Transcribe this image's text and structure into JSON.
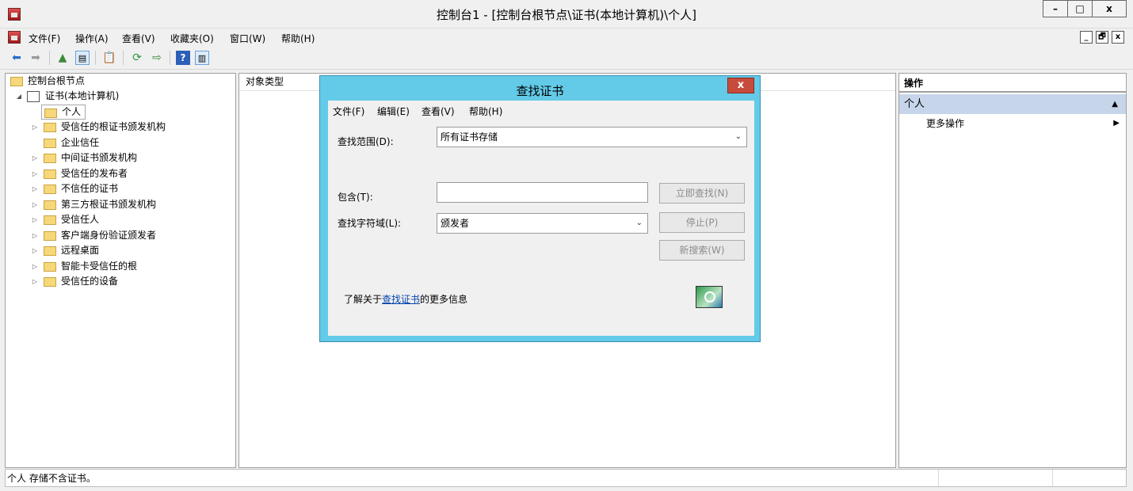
{
  "window": {
    "title": "控制台1 - [控制台根节点\\证书(本地计算机)\\个人]",
    "buttons": {
      "minimize": "–",
      "maximize": "□",
      "close": "x"
    }
  },
  "menubar": {
    "items": [
      "文件(F)",
      "操作(A)",
      "查看(V)",
      "收藏夹(O)",
      "窗口(W)",
      "帮助(H)"
    ],
    "mdi_buttons": {
      "minimize": "_",
      "restore": "🗗",
      "close": "x"
    }
  },
  "tree": {
    "root": "控制台根节点",
    "certs_node": "证书(本地计算机)",
    "children": [
      {
        "label": "个人",
        "expander": "",
        "selected": true
      },
      {
        "label": "受信任的根证书颁发机构",
        "expander": "▷"
      },
      {
        "label": "企业信任",
        "expander": ""
      },
      {
        "label": "中间证书颁发机构",
        "expander": "▷"
      },
      {
        "label": "受信任的发布者",
        "expander": "▷"
      },
      {
        "label": "不信任的证书",
        "expander": "▷"
      },
      {
        "label": "第三方根证书颁发机构",
        "expander": "▷"
      },
      {
        "label": "受信任人",
        "expander": "▷"
      },
      {
        "label": "客户端身份验证颁发者",
        "expander": "▷"
      },
      {
        "label": "远程桌面",
        "expander": "▷"
      },
      {
        "label": "智能卡受信任的根",
        "expander": "▷"
      },
      {
        "label": "受信任的设备",
        "expander": "▷"
      }
    ]
  },
  "center": {
    "column_header": "对象类型"
  },
  "actions": {
    "header": "操作",
    "section": "个人",
    "more": "更多操作"
  },
  "status": {
    "text": "个人 存储不含证书。"
  },
  "dialog": {
    "title": "查找证书",
    "close": "x",
    "menu": [
      "文件(F)",
      "编辑(E)",
      "查看(V)",
      "帮助(H)"
    ],
    "scope_label": "查找范围(D):",
    "scope_value": "所有证书存储",
    "contains_label": "包含(T):",
    "contains_value": "",
    "field_label": "查找字符域(L):",
    "field_value": "颁发者",
    "find_now": "立即查找(N)",
    "stop": "停止(P)",
    "new_search": "新搜索(W)",
    "info_prefix": "了解关于",
    "info_link": "查找证书",
    "info_suffix": "的更多信息"
  }
}
